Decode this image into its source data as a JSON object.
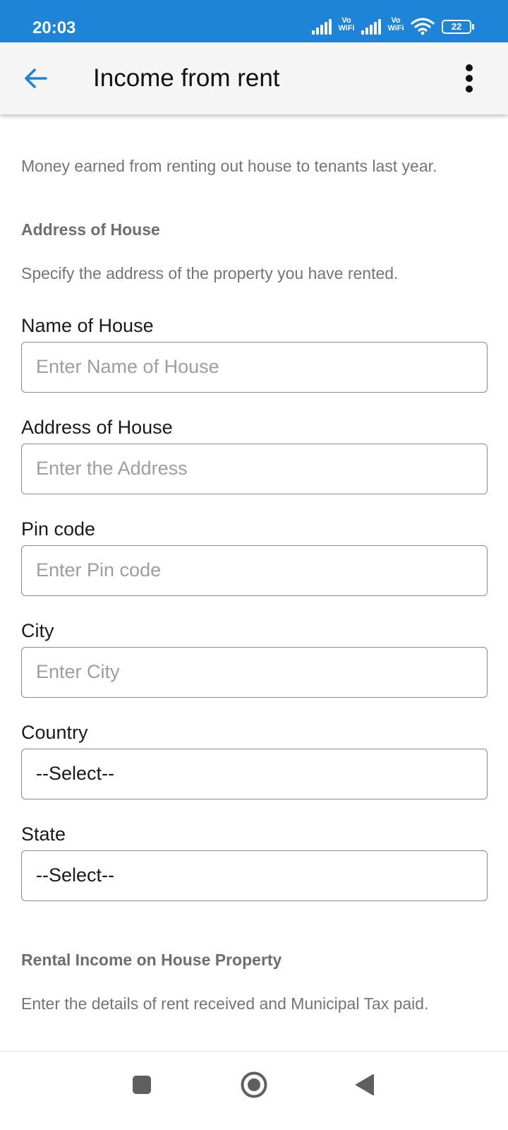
{
  "status_bar": {
    "time": "20:03",
    "vowifi_1": "Vo\nWiFi",
    "vowifi_2": "Vo\nWiFi",
    "battery": "22",
    "background": "#1e84d8"
  },
  "app_bar": {
    "title": "Income from rent",
    "back_icon": "arrow-left-icon",
    "menu_icon": "more-vert-icon",
    "accent": "#1e84d8"
  },
  "intro": "Money earned from renting out house to tenants last year.",
  "address_section": {
    "title": "Address of House",
    "description": "Specify the address of the property you have rented."
  },
  "fields": {
    "house_name": {
      "label": "Name of House",
      "placeholder": "Enter Name of House",
      "value": ""
    },
    "address": {
      "label": "Address of House",
      "placeholder": "Enter the Address",
      "value": ""
    },
    "pin_code": {
      "label": "Pin code",
      "placeholder": "Enter Pin code",
      "value": ""
    },
    "city": {
      "label": "City",
      "placeholder": "Enter City",
      "value": ""
    },
    "country": {
      "label": "Country",
      "selected": "--Select--"
    },
    "state": {
      "label": "State",
      "selected": "--Select--"
    }
  },
  "rental_section": {
    "title": "Rental Income on House Property",
    "description": "Enter the details of rent received and Municipal Tax paid."
  },
  "nav_bar": {
    "recents_icon": "square-icon",
    "home_icon": "circle-home-icon",
    "back_icon": "triangle-back-icon"
  }
}
